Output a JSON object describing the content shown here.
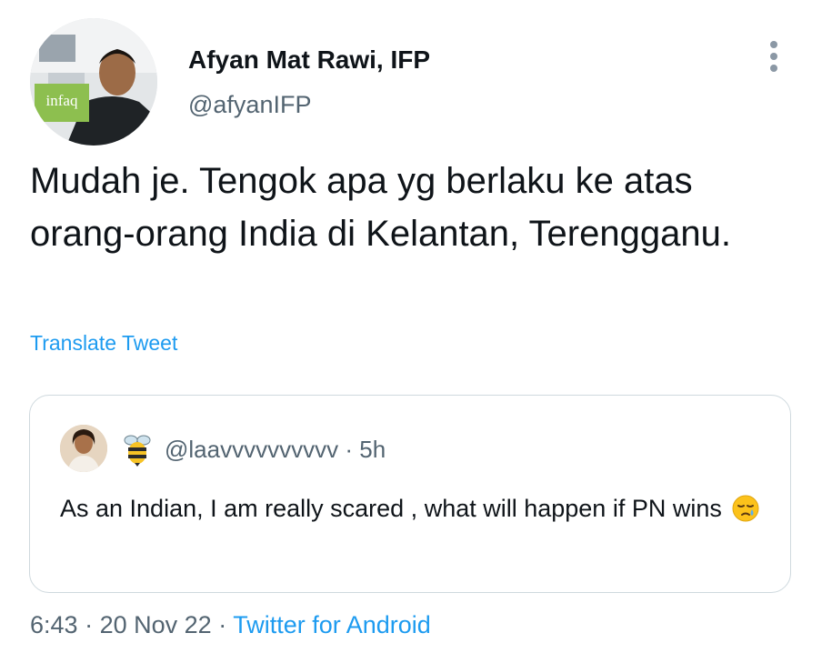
{
  "author": {
    "display_name": "Afyan Mat Rawi, IFP",
    "handle": "@afyanIFP",
    "avatar_logo_text": "infaq"
  },
  "tweet": {
    "text": "Mudah je. Tengok apa yg berlaku ke atas orang-orang India di Kelantan, Terengganu.",
    "translate_label": "Translate Tweet"
  },
  "quoted_tweet": {
    "handle": "@laavvvvvvvvvv",
    "separator": "·",
    "time_ago": "5h",
    "text": "As an Indian, I am really scared , what will happen if PN wins",
    "emoji": "sleepy-face"
  },
  "footer": {
    "time": "6:43",
    "date": "20 Nov 22",
    "source": "Twitter for Android",
    "separator": "·"
  },
  "colors": {
    "link": "#1d9bf0",
    "secondary_text": "#536471",
    "primary_text": "#0f1419",
    "border": "#cfd9de"
  }
}
